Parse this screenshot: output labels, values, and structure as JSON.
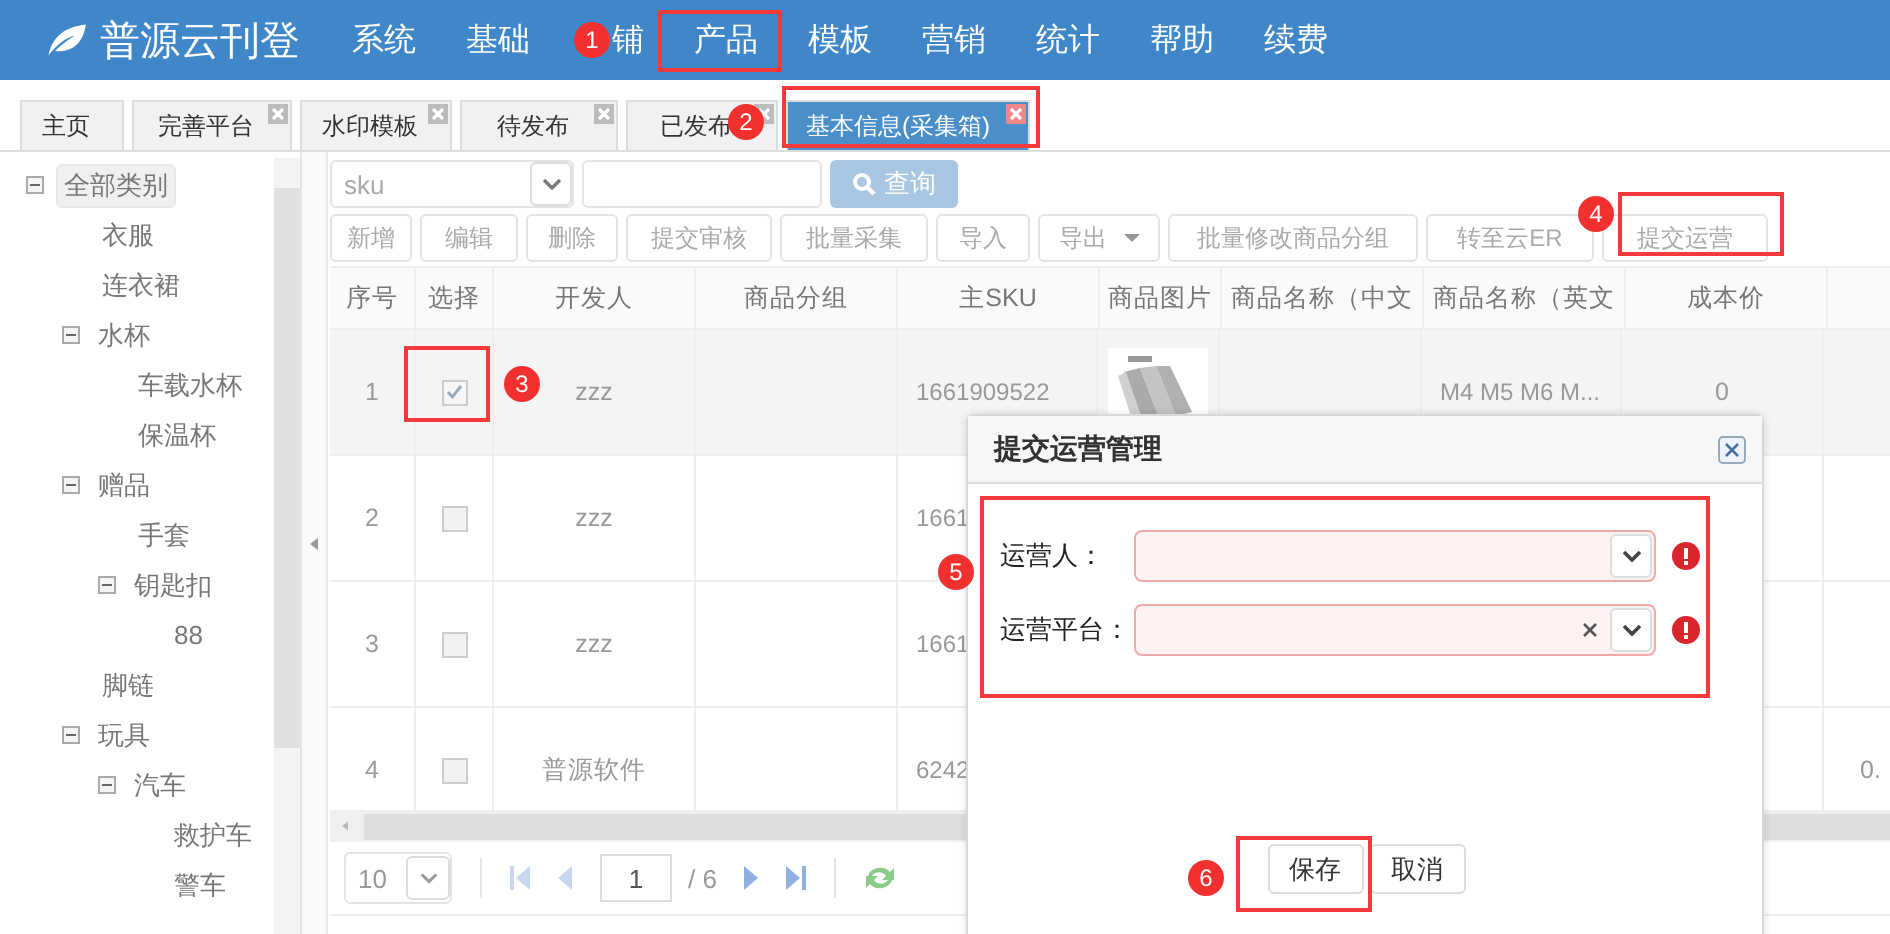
{
  "header": {
    "logo": "普源云刊登",
    "nav": [
      {
        "label": "系统"
      },
      {
        "label": "基础"
      },
      {
        "label": "铺"
      },
      {
        "label": "产品"
      },
      {
        "label": "模板"
      },
      {
        "label": "营销"
      },
      {
        "label": "统计"
      },
      {
        "label": "帮助"
      },
      {
        "label": "续费"
      }
    ]
  },
  "tabs": [
    {
      "label": "主页",
      "closable": false,
      "selected": false
    },
    {
      "label": "完善平台",
      "closable": true,
      "selected": false
    },
    {
      "label": "水印模板",
      "closable": true,
      "selected": false
    },
    {
      "label": "待发布",
      "closable": true,
      "selected": false
    },
    {
      "label": "已发布",
      "closable": true,
      "selected": false
    },
    {
      "label": "基本信息(采集箱)",
      "closable": true,
      "selected": true
    }
  ],
  "tree": [
    {
      "label": "全部类别",
      "selected": true,
      "expanded": true,
      "children": [
        {
          "label": "衣服",
          "selected": false
        },
        {
          "label": "连衣裙",
          "selected": false
        },
        {
          "label": "水杯",
          "selected": false,
          "expanded": true,
          "children": [
            {
              "label": "车载水杯",
              "selected": false
            },
            {
              "label": "保温杯",
              "selected": false
            }
          ]
        },
        {
          "label": "赠品",
          "selected": false,
          "expanded": true,
          "children": [
            {
              "label": "手套",
              "selected": false
            },
            {
              "label": "钥匙扣",
              "selected": false,
              "expanded": true,
              "children": [
                {
                  "label": "88",
                  "selected": false
                }
              ]
            }
          ]
        },
        {
          "label": "脚链",
          "selected": false
        },
        {
          "label": "玩具",
          "selected": false,
          "expanded": true,
          "children": [
            {
              "label": "汽车",
              "selected": false,
              "expanded": true,
              "children": [
                {
                  "label": "救护车",
                  "selected": false
                },
                {
                  "label": "警车",
                  "selected": false
                }
              ]
            }
          ]
        }
      ]
    }
  ],
  "search": {
    "field_value": "sku",
    "button": "查询"
  },
  "toolbar": [
    {
      "label": "新增",
      "kind": "button"
    },
    {
      "label": "编辑",
      "kind": "button"
    },
    {
      "label": "删除",
      "kind": "button"
    },
    {
      "label": "提交审核",
      "kind": "button"
    },
    {
      "label": "批量采集",
      "kind": "button"
    },
    {
      "label": "导入",
      "kind": "button"
    },
    {
      "label": "导出",
      "kind": "menu"
    },
    {
      "label": "批量修改商品分组",
      "kind": "button"
    },
    {
      "label": "转至云ER",
      "kind": "button"
    },
    {
      "label": "提交运营",
      "kind": "button"
    }
  ],
  "table": {
    "columns": [
      "序号",
      "选择",
      "开发人",
      "商品分组",
      "主SKU",
      "商品图片",
      "商品名称（中文",
      "商品名称（英文",
      "成本价"
    ],
    "rows": [
      {
        "no": "1",
        "checked": true,
        "developer": "zzz",
        "sku": "1661909522",
        "name_en": "M4 M5 M6 M...",
        "cost": "0"
      },
      {
        "no": "2",
        "checked": false,
        "developer": "zzz",
        "sku": "1661"
      },
      {
        "no": "3",
        "checked": false,
        "developer": "zzz",
        "sku": "1661"
      },
      {
        "no": "4",
        "checked": false,
        "developer": "普源软件",
        "sku": "6242",
        "column_10": "0."
      }
    ]
  },
  "pager": {
    "page_size": "10",
    "page": "1",
    "total": "/ 6"
  },
  "dialog": {
    "title": "提交运营管理",
    "fields": [
      {
        "label": "运营人：",
        "clearable": false,
        "invalid": true
      },
      {
        "label": "运营平台：",
        "clearable": true,
        "invalid": true
      }
    ],
    "buttons": [
      "保存",
      "取消"
    ]
  },
  "annotations": [
    {
      "number": "1"
    },
    {
      "number": "2"
    },
    {
      "number": "3"
    },
    {
      "number": "4"
    },
    {
      "number": "5"
    },
    {
      "number": "6"
    }
  ]
}
